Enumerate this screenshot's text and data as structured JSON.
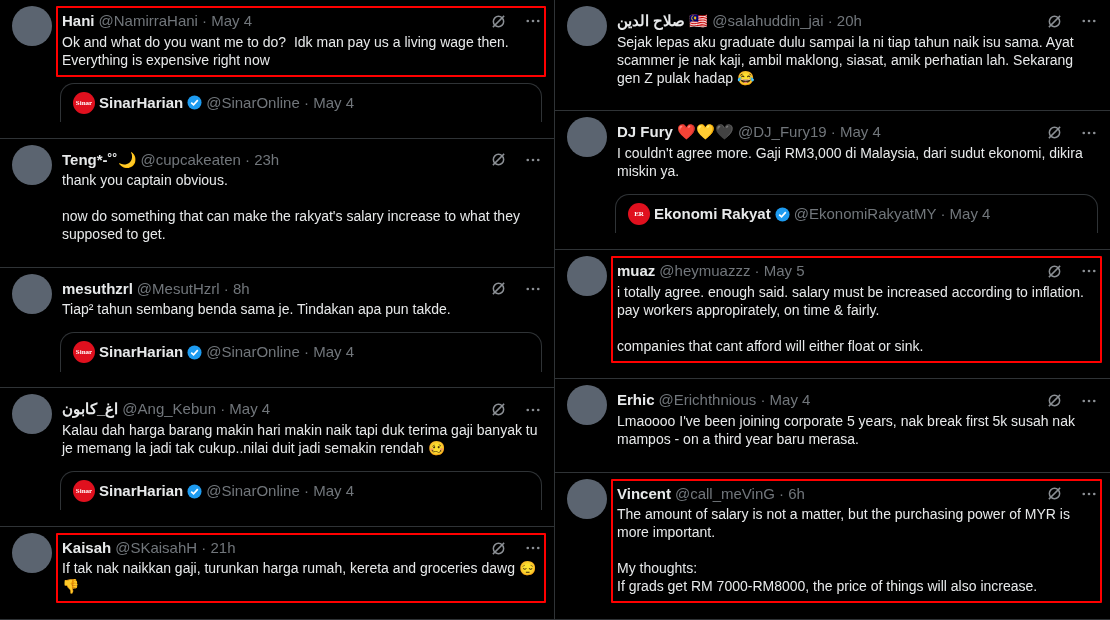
{
  "columns": [
    {
      "tweets": [
        {
          "name": "Hani",
          "meta": "@NamirraHani · May 4",
          "text": "Ok and what do you want me to do?  Idk man pay us a living wage then.\nEverything is expensive right now",
          "highlighted": true,
          "quote": {
            "logo": "Sinar",
            "name": "SinarHarian",
            "verified": true,
            "meta": "@SinarOnline · May 4"
          }
        },
        {
          "name": "Teng*-˚˚🌙",
          "meta": "@cupcakeaten · 23h",
          "text": "thank you captain obvious.\n\nnow do something that can make the rakyat's salary increase to what they supposed to get.",
          "highlighted": false
        },
        {
          "name": "mesuthzrl",
          "meta": "@MesutHzrl · 8h",
          "text": "Tiap² tahun sembang benda sama je. Tindakan apa pun takde.",
          "highlighted": false,
          "quote": {
            "logo": "Sinar",
            "name": "SinarHarian",
            "verified": true,
            "meta": "@SinarOnline · May 4"
          }
        },
        {
          "name": "اغ_كابون",
          "meta": "@Ang_Kebun · May 4",
          "text": "Kalau dah harga barang makin hari makin naik tapi duk terima gaji banyak tu je memang la jadi tak cukup..nilai duit jadi semakin rendah 🥴",
          "highlighted": false,
          "quote": {
            "logo": "Sinar",
            "name": "SinarHarian",
            "verified": true,
            "meta": "@SinarOnline · May 4"
          }
        },
        {
          "name": "Kaisah",
          "meta": "@SKaisahH · 21h",
          "text": "If tak nak naikkan gaji, turunkan harga rumah, kereta and groceries dawg 😔👎",
          "highlighted": true
        }
      ]
    },
    {
      "tweets": [
        {
          "name": "صلاح الدين 🇲🇾",
          "meta": "@salahuddin_jai · 20h",
          "text": "Sejak lepas aku graduate dulu sampai la ni tiap tahun naik isu sama. Ayat scammer je nak kaji, ambil maklong, siasat, amik perhatian lah. Sekarang gen Z pulak hadap 😂",
          "highlighted": false
        },
        {
          "name": "DJ Fury ❤️💛🖤",
          "meta": "@DJ_Fury19 · May 4",
          "text": "I couldn't agree more. Gaji RM3,000 di Malaysia, dari sudut ekonomi, dikira miskin ya.",
          "highlighted": false,
          "quote": {
            "logo": "ER",
            "name": "Ekonomi Rakyat",
            "verified": true,
            "meta": "@EkonomiRakyatMY · May 4"
          }
        },
        {
          "name": "muaz",
          "meta": "@heymuazzz · May 5",
          "text": "i totally agree. enough said. salary must be increased according to inflation. pay workers appropirately, on time & fairly.\n\ncompanies that cant afford will either float or sink.",
          "highlighted": true
        },
        {
          "name": "Erhic",
          "meta": "@Erichthnious · May 4",
          "text": "Lmaoooo I've been joining corporate 5 years, nak break first 5k susah nak mampos - on a third year baru merasa.",
          "highlighted": false
        },
        {
          "name": "Vincent",
          "meta": "@call_meVinG · 6h",
          "text": "The amount of salary is not a matter, but the purchasing power of MYR is more important.\n\nMy thoughts:\nIf grads get RM 7000-RM8000, the price of things will also increase.",
          "highlighted": true
        }
      ]
    }
  ]
}
